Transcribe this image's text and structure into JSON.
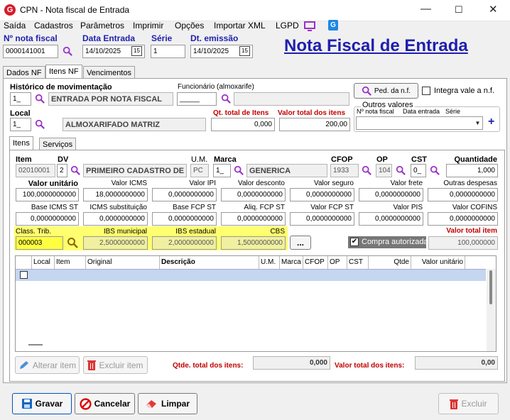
{
  "window": {
    "title": "CPN - Nota fiscal de Entrada"
  },
  "menu": [
    "Saída",
    "Cadastros",
    "Parâmetros",
    "Imprimir",
    "Opções",
    "Importar XML",
    "LGPD"
  ],
  "header": {
    "nota_label": "Nº nota fiscal",
    "nota_value": "0000141001",
    "data_entrada_label": "Data Entrada",
    "data_entrada_value": "14/10/2025",
    "serie_label": "Série",
    "serie_value": "1",
    "emissao_label": "Dt. emissão",
    "emissao_value": "14/10/2025",
    "big_title": "Nota Fiscal de Entrada",
    "cal_glyph": "15"
  },
  "tabs": [
    "Dados NF",
    "Itens NF",
    "Vencimentos"
  ],
  "itens": {
    "historico_label": "Histórico de movimentação",
    "historico_code": "1_",
    "historico_desc": "ENTRADA POR NOTA FISCAL",
    "funcionario_label": "Funcionário (almoxarife)",
    "funcionario_value": "_____",
    "ped_button": "Ped. da n.f.",
    "integra_label": "Integra vale a n.f.",
    "local_label": "Local",
    "local_code": "1_",
    "local_desc": "ALMOXARIFADO MATRIZ",
    "qt_total_label": "Qt. total de Itens",
    "qt_total_value": "0,000",
    "valor_total_label": "Valor total dos itens",
    "valor_total_value": "200,00",
    "outros_label": "Outros valores",
    "outros_cols": [
      "Nº nota fiscal",
      "Data entrada",
      "Série"
    ],
    "plus": "+"
  },
  "subtabs": [
    "Itens",
    "Serviços"
  ],
  "item": {
    "item_label": "Item",
    "item_value": "02010001",
    "dv_label": "DV",
    "dv_value": "2",
    "produto_desc": "PRIMEIRO CADASTRO DE",
    "um_label": "U.M.",
    "um_value": "PC",
    "marca_label": "Marca",
    "marca_code": "1_",
    "marca_desc": "GENERICA",
    "cfop_label": "CFOP",
    "cfop_value": "1933",
    "op_label": "OP",
    "op_value": "104",
    "cst_label": "CST",
    "cst_value": "0_",
    "qtd_label": "Quantidade",
    "qtd_value": "1,000"
  },
  "row2": [
    {
      "label": "Valor unitário",
      "value": "100,0000000000"
    },
    {
      "label": "Valor ICMS",
      "value": "18,0000000000"
    },
    {
      "label": "Valor IPI",
      "value": "0,0000000000"
    },
    {
      "label": "Valor desconto",
      "value": "0,0000000000"
    },
    {
      "label": "Valor seguro",
      "value": "0,0000000000"
    },
    {
      "label": "Valor frete",
      "value": "0,0000000000"
    },
    {
      "label": "Outras despesas",
      "value": "0,0000000000"
    }
  ],
  "row3": [
    {
      "label": "Base ICMS ST",
      "value": "0,0000000000"
    },
    {
      "label": "ICMS substituição",
      "value": "0,0000000000"
    },
    {
      "label": "Base FCP ST",
      "value": "0,0000000000"
    },
    {
      "label": "Aliq. FCP ST",
      "value": "0,0000000000"
    },
    {
      "label": "Valor FCP ST",
      "value": "0,0000000000"
    },
    {
      "label": "Valor PIS",
      "value": "0,0000000000"
    },
    {
      "label": "Valor COFINS",
      "value": "0,0000000000"
    }
  ],
  "trib": {
    "class_label": "Class. Trib.",
    "class_value": "000003",
    "ibs_mun_label": "IBS municipal",
    "ibs_mun_value": "2,5000000000",
    "ibs_est_label": "IBS estadual",
    "ibs_est_value": "2,0000000000",
    "cbs_label": "CBS",
    "cbs_value": "1,5000000000",
    "dots": "...",
    "compra_label": "Compra autorizada",
    "compra_check": "✔",
    "valor_item_label": "Valor total item",
    "valor_item_value": "100,000000"
  },
  "grid_cols": [
    "Local",
    "Item",
    "Original",
    "Descrição",
    "U.M.",
    "Marca",
    "CFOP",
    "OP",
    "CST",
    "Qtde",
    "Valor unitário"
  ],
  "bottom": {
    "alterar": "Alterar item",
    "excluir_item": "Excluir item",
    "qtde_label": "Qtde. total dos itens:",
    "qtde_value": "0,000",
    "valor_label": "Valor total dos itens:",
    "valor_value": "0,00"
  },
  "footer": {
    "gravar": "Gravar",
    "cancelar": "Cancelar",
    "limpar": "Limpar",
    "excluir": "Excluir"
  },
  "colors": {
    "accent": "#1f1fae",
    "red": "#c00000",
    "highlight": "#ffff70",
    "magnifier": "#9b30c8"
  }
}
